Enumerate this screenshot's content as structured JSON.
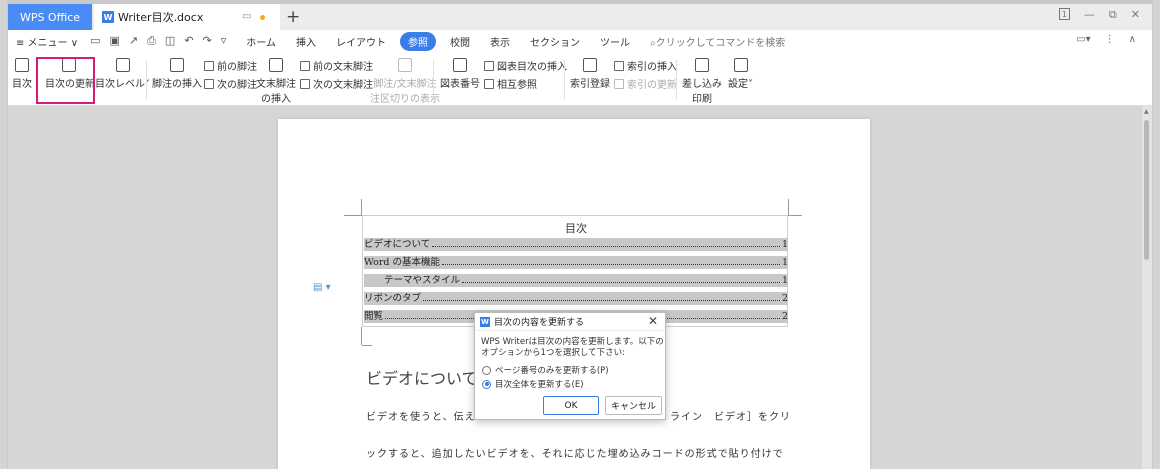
{
  "tabs": {
    "app": "WPS Office",
    "doc": "Writer目次.docx",
    "new_tab": "+"
  },
  "menubar": {
    "menu": "≡ メニュー ∨",
    "items": [
      "ホーム",
      "挿入",
      "レイアウト",
      "参照",
      "校閲",
      "表示",
      "セクション",
      "ツール"
    ],
    "active": "参照",
    "search": "クリックしてコマンドを検索"
  },
  "ribbon": {
    "toc": "目次",
    "toc_update": "目次の更新",
    "toc_level": "目次レベル",
    "insert_footnote": "脚注の挿入",
    "prev_footnote": "前の脚注",
    "next_footnote": "次の脚注",
    "insert_endnote_1": "文末脚注",
    "insert_endnote_2": "の挿入",
    "prev_endnote": "前の文末脚注",
    "next_endnote": "次の文末脚注",
    "fn_sep_1": "脚注/文末脚注",
    "fn_sep_2": "注区切りの表示",
    "caption": "図表番号",
    "insert_tof": "図表目次の挿入",
    "cross_ref": "相互参照",
    "mark_index": "索引登録",
    "insert_index": "索引の挿入",
    "update_index": "索引の更新",
    "mail_merge_1": "差し込み",
    "mail_merge_2": "印刷",
    "settings": "設定"
  },
  "document": {
    "toc_title": "目次",
    "toc_entries": [
      {
        "text": "ビデオについて",
        "page": "1"
      },
      {
        "text": "Word の基本機能",
        "page": "1"
      },
      {
        "text": "テーマやスタイル",
        "page": "1"
      },
      {
        "text": "リボンのタブ",
        "page": "2"
      },
      {
        "text": "閲覧",
        "page": "2"
      }
    ],
    "heading": "ビデオについて",
    "body_line1": "ビデオを使うと、伝え",
    "body_line1b": "ライン　ビデオ］をクリ",
    "body_line2": "ックすると、追加したいビデオを、それに応じた埋め込みコードの形式で貼り付けで"
  },
  "dialog": {
    "title": "目次の内容を更新する",
    "message": "WPS Writerは目次の内容を更新します。以下のオプションから1つを選択して下さい:",
    "option_page": "ページ番号のみを更新する(P)",
    "option_all": "目次全体を更新する(E)",
    "ok": "OK",
    "cancel": "キャンセル"
  }
}
